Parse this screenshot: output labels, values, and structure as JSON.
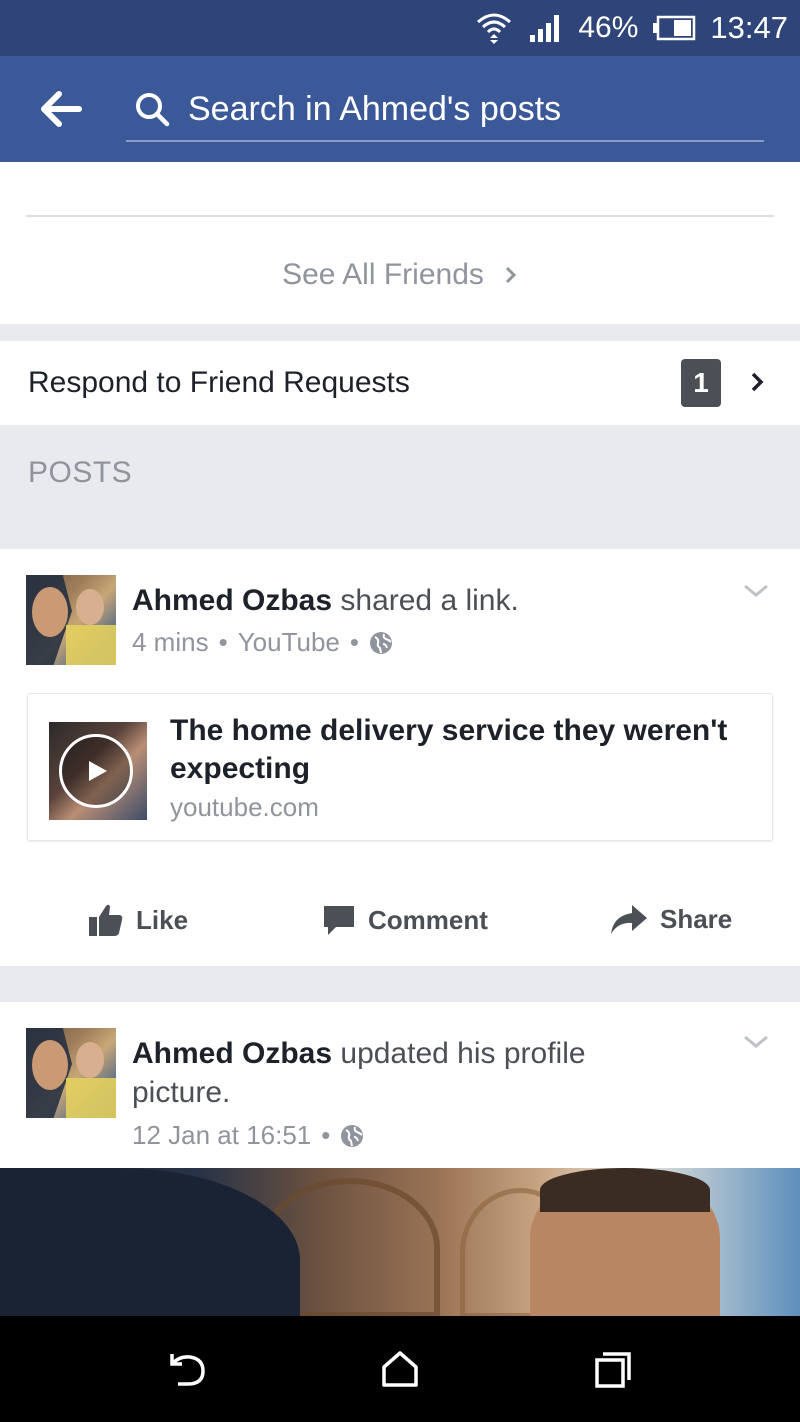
{
  "status_bar": {
    "battery_percent": "46%",
    "time": "13:47",
    "icons": [
      "wifi-icon",
      "signal-icon",
      "battery-icon"
    ]
  },
  "app_bar": {
    "back_icon": "arrow-left-icon",
    "search_icon": "search-icon",
    "search_placeholder": "Search in Ahmed's posts",
    "accent_color": "#3b5998"
  },
  "friends": {
    "see_all_label": "See All Friends"
  },
  "friend_requests": {
    "label": "Respond to Friend Requests",
    "count": "1"
  },
  "posts_section": {
    "header": "POSTS"
  },
  "posts": [
    {
      "author": "Ahmed Ozbas",
      "action": " shared a link.",
      "time": "4 mins",
      "source": "YouTube",
      "privacy_icon": "globe-icon",
      "link": {
        "title": "The home delivery service they weren't expecting",
        "domain": "youtube.com",
        "thumbnail_icon": "play-icon"
      },
      "actions": {
        "like": "Like",
        "comment": "Comment",
        "share": "Share"
      }
    },
    {
      "author": "Ahmed Ozbas",
      "action": " updated his profile picture.",
      "time": "12 Jan at 16:51",
      "privacy_icon": "globe-icon"
    }
  ],
  "nav_bar": {
    "icons": [
      "back-icon",
      "home-icon",
      "recent-apps-icon"
    ]
  }
}
